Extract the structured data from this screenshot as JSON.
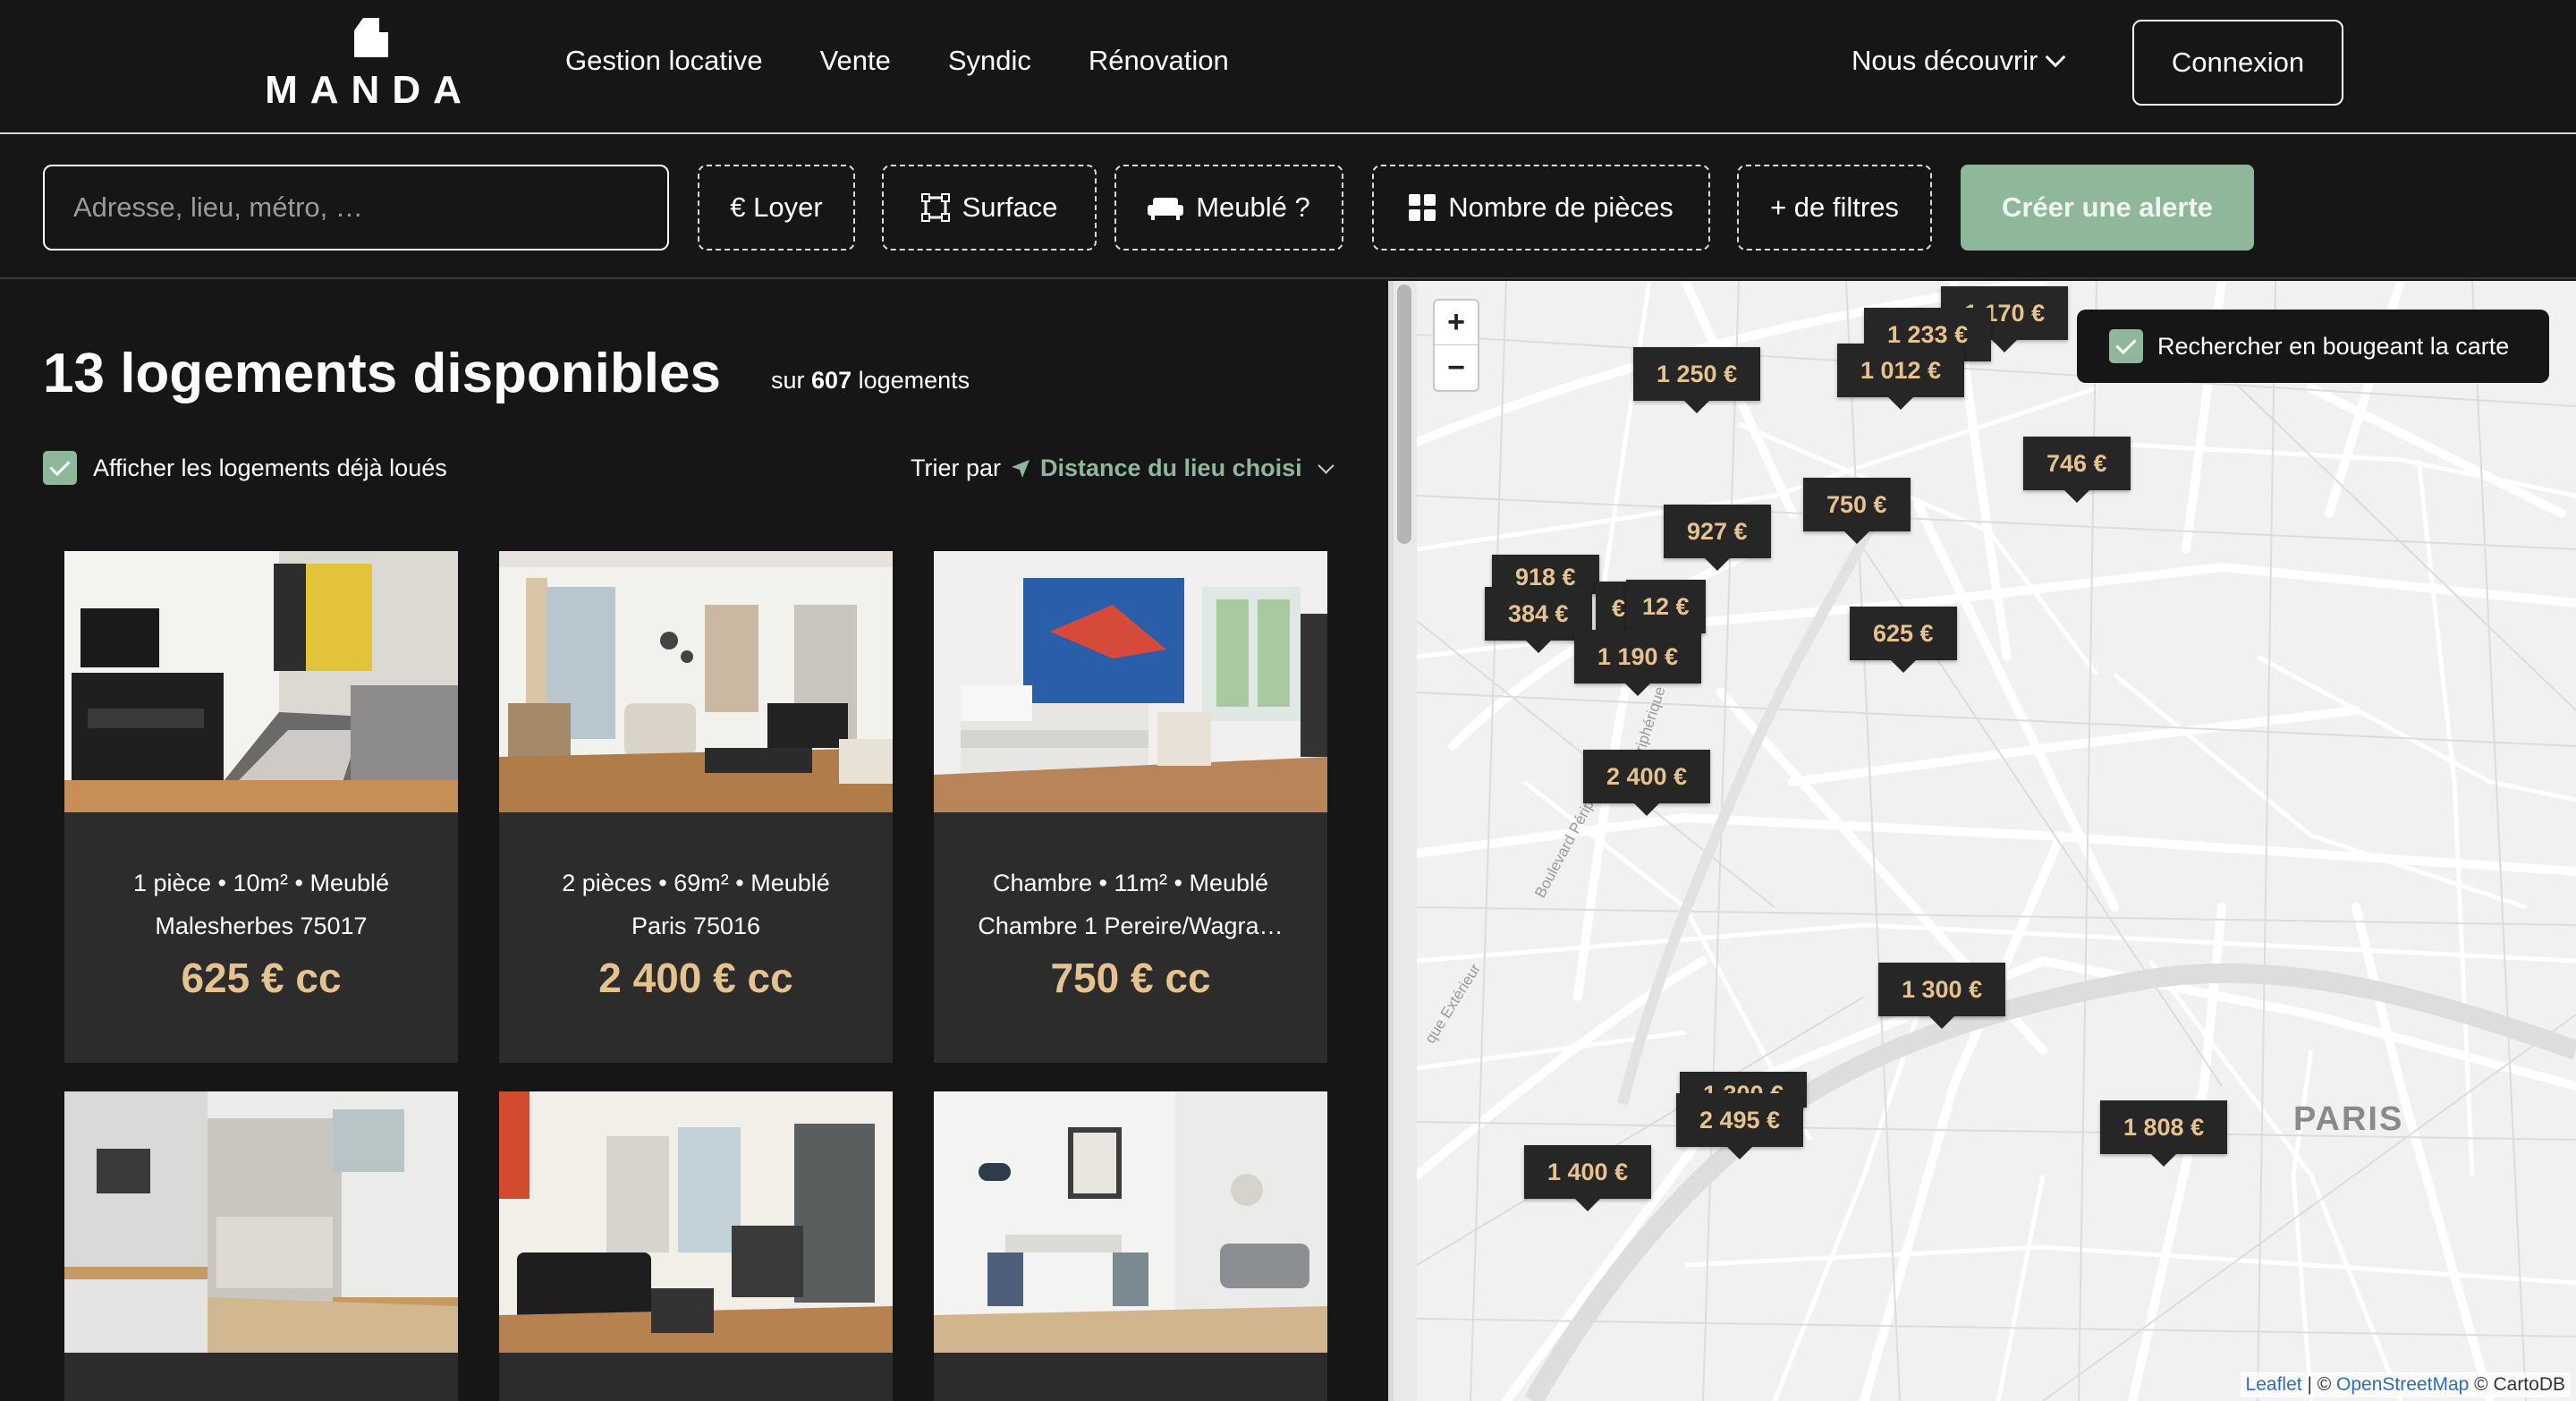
{
  "brand": {
    "name": "MANDA"
  },
  "nav": {
    "items": [
      "Gestion locative",
      "Vente",
      "Syndic",
      "Rénovation"
    ],
    "discover_label": "Nous découvrir",
    "login_label": "Connexion"
  },
  "filters": {
    "search_placeholder": "Adresse, lieu, métro, …",
    "rent_label": "€ Loyer",
    "surface_label": "Surface",
    "furnished_label": "Meublé ?",
    "rooms_label": "Nombre de pièces",
    "more_label": "+ de filtres",
    "alert_label": "Créer une alerte"
  },
  "results": {
    "title": "13 logements disponibles",
    "sub_prefix": "sur",
    "sub_total": "607",
    "sub_suffix": "logements",
    "show_rented_label": "Afficher les logements déjà loués",
    "show_rented_checked": true,
    "sort_label": "Trier par",
    "sort_value": "Distance du lieu choisi"
  },
  "listings": [
    {
      "details": "1 pièce • 10m² • Meublé",
      "location": "Malesherbes 75017",
      "price": "625 € cc"
    },
    {
      "details": "2 pièces • 69m² • Meublé",
      "location": "Paris 75016",
      "price": "2 400 € cc"
    },
    {
      "details": "Chambre • 11m² • Meublé",
      "location": "Chambre 1 Pereire/Wagra…",
      "price": "750 € cc"
    },
    {
      "details": "",
      "location": "",
      "price": ""
    },
    {
      "details": "",
      "location": "",
      "price": ""
    },
    {
      "details": "",
      "location": "",
      "price": ""
    }
  ],
  "map": {
    "toggle_label": "Rechercher en bougeant la carte",
    "toggle_checked": true,
    "zoom_in": "+",
    "zoom_out": "−",
    "city_label": "PARIS",
    "street_labels": [
      "Boulevard Périphérique",
      "que Extérieur",
      "Périphérique"
    ],
    "markers": [
      "1 170 €",
      "1 233 €",
      "1 012 €",
      "1 250 €",
      "746 €",
      "750 €",
      "927 €",
      "918 €",
      "384 €",
      "€",
      "12 €",
      "1 190 €",
      "625 €",
      "2 400 €",
      "1 300 €",
      "1 808 €",
      "1 300 €",
      "2 495 €",
      "1 400 €"
    ],
    "attribution": {
      "leaflet": "Leaflet",
      "sep": " | © ",
      "osm": "OpenStreetMap",
      "mid": " © ",
      "carto": "CartoDB"
    }
  },
  "colors": {
    "background": "#161616",
    "accent_green": "#8fb79a",
    "price_gold": "#e6c38e",
    "card_bg": "#2c2c2c"
  },
  "icons": [
    "logo-mark-icon",
    "chevron-down-icon",
    "surface-icon",
    "sofa-icon",
    "grid-icon",
    "navigation-arrow-icon",
    "checkbox-icon",
    "zoom-in-icon",
    "zoom-out-icon"
  ]
}
